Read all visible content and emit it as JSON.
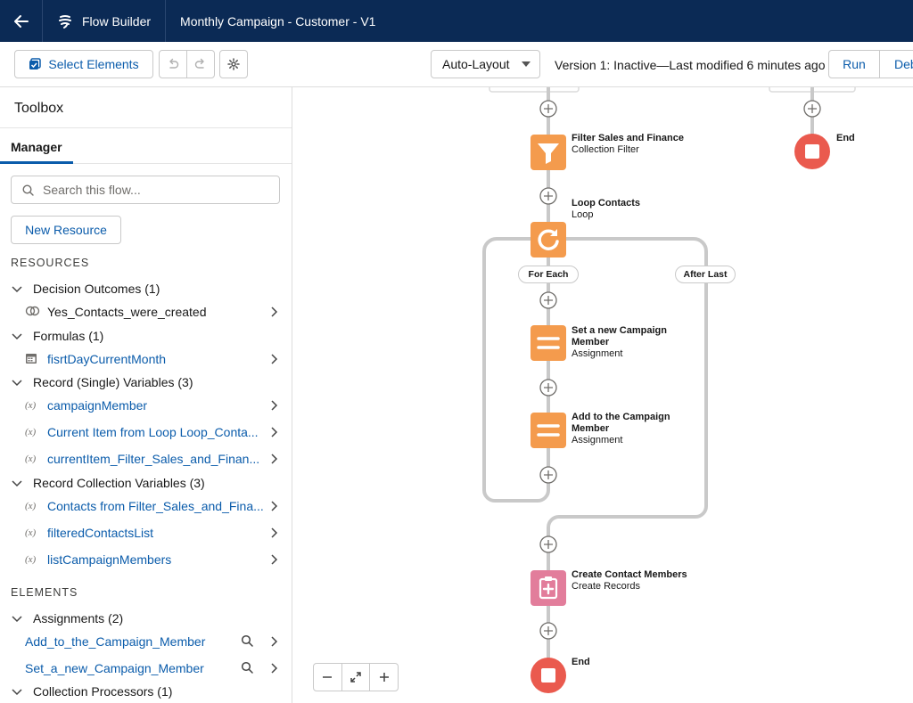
{
  "header": {
    "app_name": "Flow Builder",
    "flow_title": "Monthly Campaign - Customer - V1"
  },
  "toolbar": {
    "select_elements": "Select Elements",
    "layout_mode": "Auto-Layout",
    "version_status": "Version 1: Inactive—Last modified 6 minutes ago",
    "run": "Run",
    "debug": "Deb"
  },
  "sidebar": {
    "title": "Toolbox",
    "tab": "Manager",
    "search_placeholder": "Search this flow...",
    "new_resource": "New Resource",
    "resources_label": "RESOURCES",
    "resource_groups": [
      {
        "label": "Decision Outcomes (1)",
        "items": [
          "Yes_Contacts_were_created"
        ]
      },
      {
        "label": "Formulas (1)",
        "items": [
          "fisrtDayCurrentMonth"
        ]
      },
      {
        "label": "Record (Single) Variables (3)",
        "items": [
          "campaignMember",
          "Current Item from Loop Loop_Conta...",
          "currentItem_Filter_Sales_and_Finan..."
        ]
      },
      {
        "label": "Record Collection Variables (3)",
        "items": [
          "Contacts from Filter_Sales_and_Fina...",
          "filteredContactsList",
          "listCampaignMembers"
        ]
      }
    ],
    "elements_label": "ELEMENTS",
    "element_groups": [
      {
        "label": "Assignments (2)",
        "items": [
          "Add_to_the_Campaign_Member",
          "Set_a_new_Campaign_Member"
        ]
      },
      {
        "label": "Collection Processors (1)",
        "items": []
      }
    ]
  },
  "canvas": {
    "nodes": {
      "filter": {
        "title": "Filter Sales and Finance",
        "type": "Collection Filter"
      },
      "loop": {
        "title": "Loop Contacts",
        "type": "Loop"
      },
      "set_member": {
        "title_line1": "Set a new Campaign",
        "title_line2": "Member",
        "type": "Assignment"
      },
      "add_member": {
        "title_line1": "Add to the Campaign",
        "title_line2": "Member",
        "type": "Assignment"
      },
      "create": {
        "title": "Create Contact Members",
        "type": "Create Records"
      },
      "end_main": {
        "title": "End"
      },
      "end_right": {
        "title": "End"
      }
    },
    "branches": {
      "for_each": "For Each",
      "after_last": "After Last"
    }
  },
  "colors": {
    "header_bg": "#0b2a55",
    "accent_blue": "#0b5cab",
    "node_orange": "#f49b4d",
    "node_pink": "#e27d9b",
    "end_red": "#ea5a4e",
    "connector_gray": "#c9c9c9"
  }
}
